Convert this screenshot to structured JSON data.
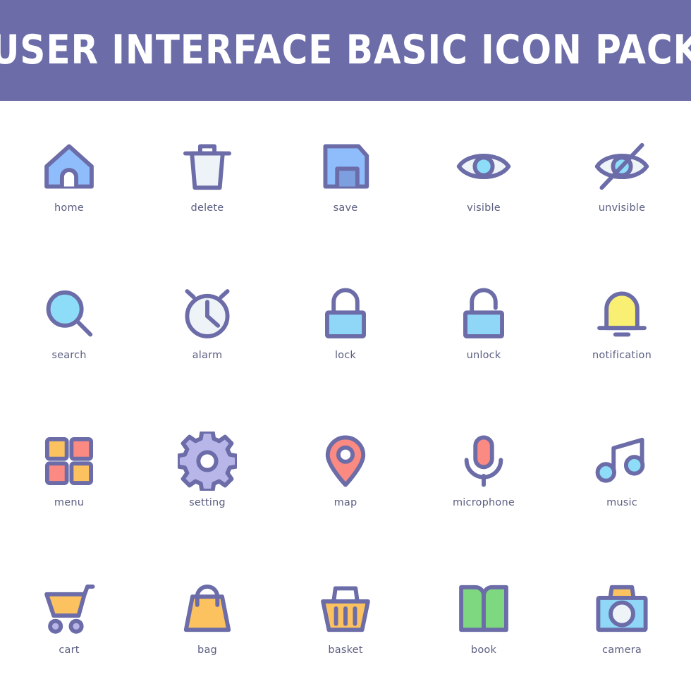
{
  "header": {
    "title": "USER INTERFACE BASIC ICON PACK",
    "background_color": "#6b6ca8",
    "text_color": "#ffffff"
  },
  "page": {
    "background_color": "#ffffff",
    "label_color": "#5b5f80",
    "stroke_color": "#6b6ca8",
    "columns": 5,
    "rows": 4
  },
  "palette": {
    "purple_stroke": "#6b6ca8",
    "periwinkle_fill": "#b8b5e8",
    "blue_fill": "#8fbcfb",
    "blue_dark_fill": "#7d9fe0",
    "cyan_fill": "#8ddcf8",
    "cyan_body": "#8fd6f7",
    "pale_fill": "#eef3f8",
    "yellow_fill": "#f9ef72",
    "orange_fill": "#fbc25f",
    "salmon_fill": "#fb8a82",
    "green_fill": "#7dd87f",
    "white": "#ffffff"
  },
  "icons": [
    {
      "id": "home",
      "label": "home",
      "icon_name": "home-icon"
    },
    {
      "id": "delete",
      "label": "delete",
      "icon_name": "trash-delete-icon"
    },
    {
      "id": "save",
      "label": "save",
      "icon_name": "floppy-save-icon"
    },
    {
      "id": "visible",
      "label": "visible",
      "icon_name": "eye-visible-icon"
    },
    {
      "id": "unvisible",
      "label": "unvisible",
      "icon_name": "eye-slash-unvisible-icon"
    },
    {
      "id": "search",
      "label": "search",
      "icon_name": "magnifier-search-icon"
    },
    {
      "id": "alarm",
      "label": "alarm",
      "icon_name": "alarm-clock-icon"
    },
    {
      "id": "lock",
      "label": "lock",
      "icon_name": "padlock-locked-icon"
    },
    {
      "id": "unlock",
      "label": "unlock",
      "icon_name": "padlock-unlocked-icon"
    },
    {
      "id": "notification",
      "label": "notification",
      "icon_name": "bell-notification-icon"
    },
    {
      "id": "menu",
      "label": "menu",
      "icon_name": "grid-menu-icon"
    },
    {
      "id": "setting",
      "label": "setting",
      "icon_name": "gear-setting-icon"
    },
    {
      "id": "map",
      "label": "map",
      "icon_name": "map-pin-icon"
    },
    {
      "id": "microphone",
      "label": "microphone",
      "icon_name": "microphone-icon"
    },
    {
      "id": "music",
      "label": "music",
      "icon_name": "music-note-icon"
    },
    {
      "id": "cart",
      "label": "cart",
      "icon_name": "shopping-cart-icon"
    },
    {
      "id": "bag",
      "label": "bag",
      "icon_name": "shopping-bag-icon"
    },
    {
      "id": "basket",
      "label": "basket",
      "icon_name": "shopping-basket-icon"
    },
    {
      "id": "book",
      "label": "book",
      "icon_name": "open-book-icon"
    },
    {
      "id": "camera",
      "label": "camera",
      "icon_name": "camera-icon"
    }
  ]
}
